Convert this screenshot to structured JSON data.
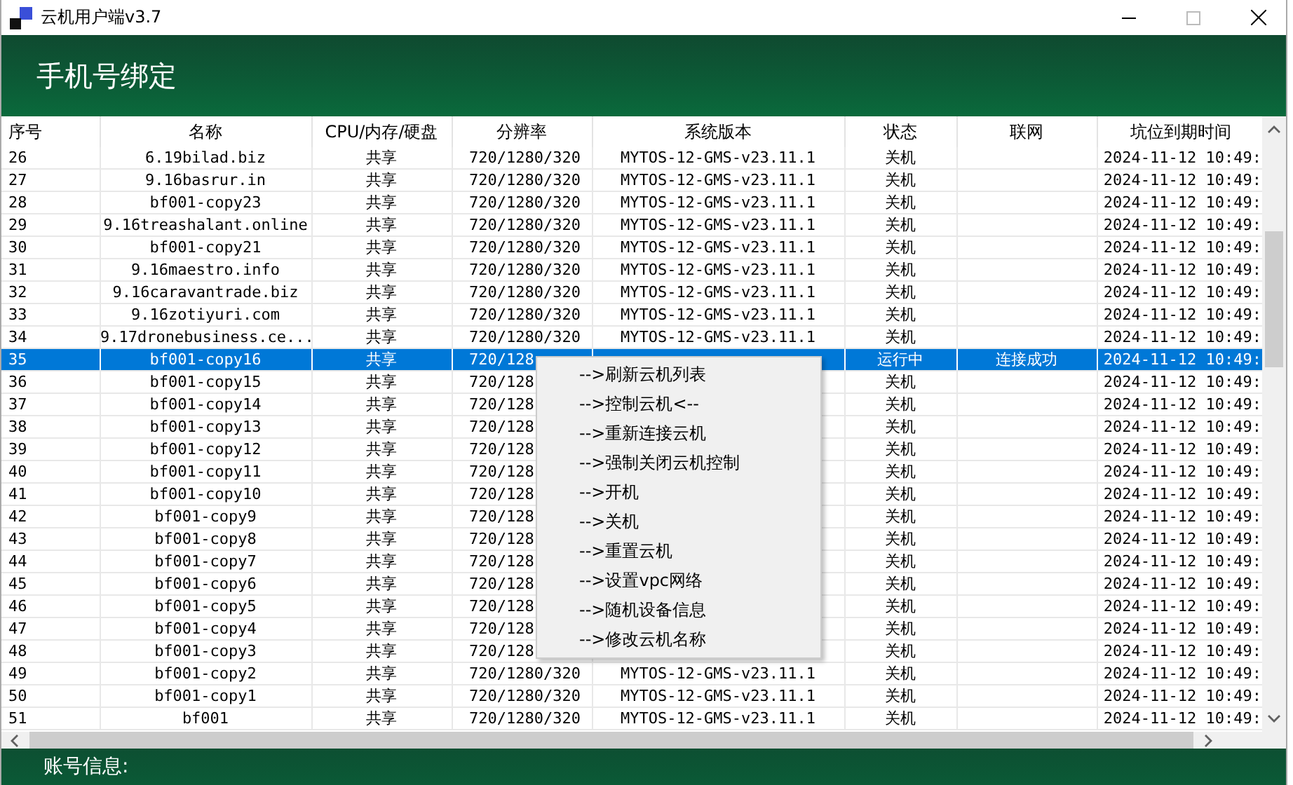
{
  "window": {
    "title": "云机用户端v3.7"
  },
  "header": {
    "title": "手机号绑定"
  },
  "table": {
    "columns": [
      "序号",
      "名称",
      "CPU/内存/硬盘",
      "分辨率",
      "系统版本",
      "状态",
      "联网",
      "坑位到期时间"
    ],
    "rows": [
      {
        "no": "26",
        "name": "6.19bilad.biz",
        "spec": "共享",
        "resolution": "720/1280/320",
        "os": "MYTOS-12-GMS-v23.11.1",
        "status": "关机",
        "expiry": "2024-11-12 10:49:",
        "selected": false
      },
      {
        "no": "27",
        "name": "9.16basrur.in",
        "spec": "共享",
        "resolution": "720/1280/320",
        "os": "MYTOS-12-GMS-v23.11.1",
        "status": "关机",
        "expiry": "2024-11-12 10:49:",
        "selected": false
      },
      {
        "no": "28",
        "name": "bf001-copy23",
        "spec": "共享",
        "resolution": "720/1280/320",
        "os": "MYTOS-12-GMS-v23.11.1",
        "status": "关机",
        "expiry": "2024-11-12 10:49:",
        "selected": false
      },
      {
        "no": "29",
        "name": "9.16treashalant.online",
        "spec": "共享",
        "resolution": "720/1280/320",
        "os": "MYTOS-12-GMS-v23.11.1",
        "status": "关机",
        "expiry": "2024-11-12 10:49:",
        "selected": false
      },
      {
        "no": "30",
        "name": "bf001-copy21",
        "spec": "共享",
        "resolution": "720/1280/320",
        "os": "MYTOS-12-GMS-v23.11.1",
        "status": "关机",
        "expiry": "2024-11-12 10:49:",
        "selected": false
      },
      {
        "no": "31",
        "name": "9.16maestro.info",
        "spec": "共享",
        "resolution": "720/1280/320",
        "os": "MYTOS-12-GMS-v23.11.1",
        "status": "关机",
        "expiry": "2024-11-12 10:49:",
        "selected": false
      },
      {
        "no": "32",
        "name": "9.16caravantrade.biz",
        "spec": "共享",
        "resolution": "720/1280/320",
        "os": "MYTOS-12-GMS-v23.11.1",
        "status": "关机",
        "expiry": "2024-11-12 10:49:",
        "selected": false
      },
      {
        "no": "33",
        "name": "9.16zotiyuri.com",
        "spec": "共享",
        "resolution": "720/1280/320",
        "os": "MYTOS-12-GMS-v23.11.1",
        "status": "关机",
        "expiry": "2024-11-12 10:49:",
        "selected": false
      },
      {
        "no": "34",
        "name": "9.17dronebusiness.ce...",
        "spec": "共享",
        "resolution": "720/1280/320",
        "os": "MYTOS-12-GMS-v23.11.1",
        "status": "关机",
        "expiry": "2024-11-12 10:49:",
        "selected": false
      },
      {
        "no": "35",
        "name": "bf001-copy16",
        "spec": "共享",
        "resolution": "720/128",
        "status": "运行中",
        "network": "连接成功",
        "expiry": "2024-11-12 10:49:",
        "selected": true
      },
      {
        "no": "36",
        "name": "bf001-copy15",
        "spec": "共享",
        "resolution": "720/128",
        "status": "关机",
        "expiry": "2024-11-12 10:49:",
        "selected": false
      },
      {
        "no": "37",
        "name": "bf001-copy14",
        "spec": "共享",
        "resolution": "720/128",
        "status": "关机",
        "expiry": "2024-11-12 10:49:",
        "selected": false
      },
      {
        "no": "38",
        "name": "bf001-copy13",
        "spec": "共享",
        "resolution": "720/128",
        "status": "关机",
        "expiry": "2024-11-12 10:49:",
        "selected": false
      },
      {
        "no": "39",
        "name": "bf001-copy12",
        "spec": "共享",
        "resolution": "720/128",
        "status": "关机",
        "expiry": "2024-11-12 10:49:",
        "selected": false
      },
      {
        "no": "40",
        "name": "bf001-copy11",
        "spec": "共享",
        "resolution": "720/128",
        "status": "关机",
        "expiry": "2024-11-12 10:49:",
        "selected": false
      },
      {
        "no": "41",
        "name": "bf001-copy10",
        "spec": "共享",
        "resolution": "720/128",
        "status": "关机",
        "expiry": "2024-11-12 10:49:",
        "selected": false
      },
      {
        "no": "42",
        "name": "bf001-copy9",
        "spec": "共享",
        "resolution": "720/128",
        "status": "关机",
        "expiry": "2024-11-12 10:49:",
        "selected": false
      },
      {
        "no": "43",
        "name": "bf001-copy8",
        "spec": "共享",
        "resolution": "720/128",
        "status": "关机",
        "expiry": "2024-11-12 10:49:",
        "selected": false
      },
      {
        "no": "44",
        "name": "bf001-copy7",
        "spec": "共享",
        "resolution": "720/128",
        "status": "关机",
        "expiry": "2024-11-12 10:49:",
        "selected": false
      },
      {
        "no": "45",
        "name": "bf001-copy6",
        "spec": "共享",
        "resolution": "720/128",
        "status": "关机",
        "expiry": "2024-11-12 10:49:",
        "selected": false
      },
      {
        "no": "46",
        "name": "bf001-copy5",
        "spec": "共享",
        "resolution": "720/128",
        "status": "关机",
        "expiry": "2024-11-12 10:49:",
        "selected": false
      },
      {
        "no": "47",
        "name": "bf001-copy4",
        "spec": "共享",
        "resolution": "720/128",
        "status": "关机",
        "expiry": "2024-11-12 10:49:",
        "selected": false
      },
      {
        "no": "48",
        "name": "bf001-copy3",
        "spec": "共享",
        "resolution": "720/128",
        "status": "关机",
        "expiry": "2024-11-12 10:49:",
        "selected": false
      },
      {
        "no": "49",
        "name": "bf001-copy2",
        "spec": "共享",
        "resolution": "720/1280/320",
        "os": "MYTOS-12-GMS-v23.11.1",
        "status": "关机",
        "expiry": "2024-11-12 10:49:",
        "selected": false
      },
      {
        "no": "50",
        "name": "bf001-copy1",
        "spec": "共享",
        "resolution": "720/1280/320",
        "os": "MYTOS-12-GMS-v23.11.1",
        "status": "关机",
        "expiry": "2024-11-12 10:49:",
        "selected": false
      },
      {
        "no": "51",
        "name": "bf001",
        "spec": "共享",
        "resolution": "720/1280/320",
        "os": "MYTOS-12-GMS-v23.11.1",
        "status": "关机",
        "expiry": "2024-11-12 10:49:",
        "selected": false
      }
    ]
  },
  "context_menu": {
    "items": [
      "-->刷新云机列表",
      "-->控制云机<--",
      "-->重新连接云机",
      "-->强制关闭云机控制",
      "-->开机",
      "-->关机",
      "-->重置云机",
      "-->设置vpc网络",
      "-->随机设备信息",
      "-->修改云机名称"
    ]
  },
  "footer": {
    "label": "账号信息:"
  }
}
